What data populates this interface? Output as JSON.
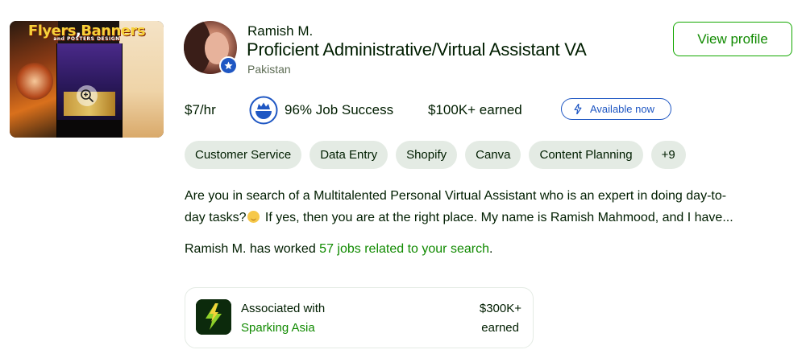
{
  "portfolio": {
    "headline_main": "Flyers",
    "headline_comma": ",",
    "headline_second": "Banners",
    "headline_small": "and POSTERS DESIGN"
  },
  "freelancer": {
    "name": "Ramish M.",
    "title": "Proficient Administrative/Virtual Assistant VA",
    "country": "Pakistan",
    "view_profile_label": "View profile"
  },
  "stats": {
    "rate": "$7/hr",
    "job_success": "96% Job Success",
    "earned": "$100K+ earned",
    "availability": "Available now"
  },
  "skills": [
    "Customer Service",
    "Data Entry",
    "Shopify",
    "Canva",
    "Content Planning",
    "+9"
  ],
  "description": {
    "line1": "Are you in search of a Multitalented Personal Virtual Assistant who is an expert in doing day-to-",
    "line2_a": "day tasks?",
    "line2_b": " If yes, then you are at the right place. My name is Ramish Mahmood, and I have..."
  },
  "worked": {
    "prefix": "Ramish M. has worked ",
    "link": "57 jobs related to your search",
    "suffix": "."
  },
  "agency": {
    "associated_label": "Associated with",
    "name": "Sparking Asia",
    "amount": "$300K+",
    "amount_label": "earned",
    "logo_text": "SPARKING ASIA"
  },
  "colors": {
    "accent_green": "#14a800",
    "link_green": "#108a00",
    "badge_blue": "#1f57c3",
    "chip_bg": "#e4ebe4"
  }
}
